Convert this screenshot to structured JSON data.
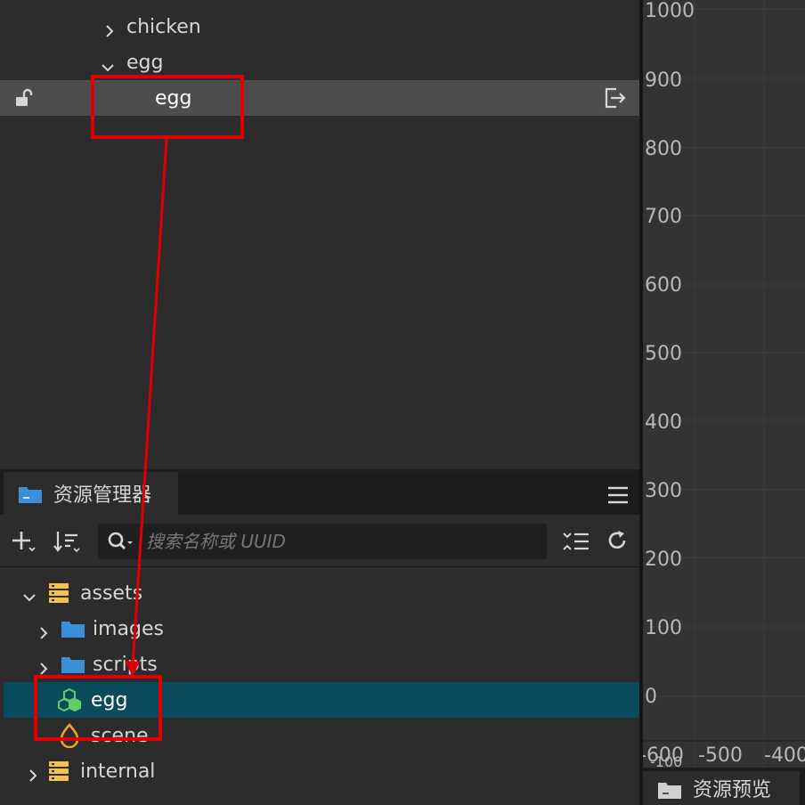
{
  "hierarchy": {
    "items": [
      {
        "label": "chicken"
      },
      {
        "label": "egg"
      },
      {
        "label": "egg"
      }
    ]
  },
  "scene": {
    "y_ticks": [
      "1000",
      "900",
      "800",
      "700",
      "600",
      "500",
      "400",
      "300",
      "200",
      "100",
      "0"
    ],
    "x_ticks": [
      "-600",
      "-500",
      "-400"
    ],
    "x_tick_overlap": "-100"
  },
  "assets_panel": {
    "tab_title": "资源管理器",
    "search_placeholder": "搜索名称或 UUID",
    "tree": [
      {
        "label": "assets"
      },
      {
        "label": "images"
      },
      {
        "label": "scripts"
      },
      {
        "label": "egg"
      },
      {
        "label": "scene"
      },
      {
        "label": "internal"
      }
    ]
  },
  "preview_panel": {
    "tab_title": "资源预览"
  },
  "colors": {
    "accent_selected_asset": "#0b4a5a",
    "annotation_red": "#e00000",
    "folder_blue": "#3a8fd8",
    "db_yellow": "#f2c14e",
    "prefab_green": "#5fcf6a"
  }
}
